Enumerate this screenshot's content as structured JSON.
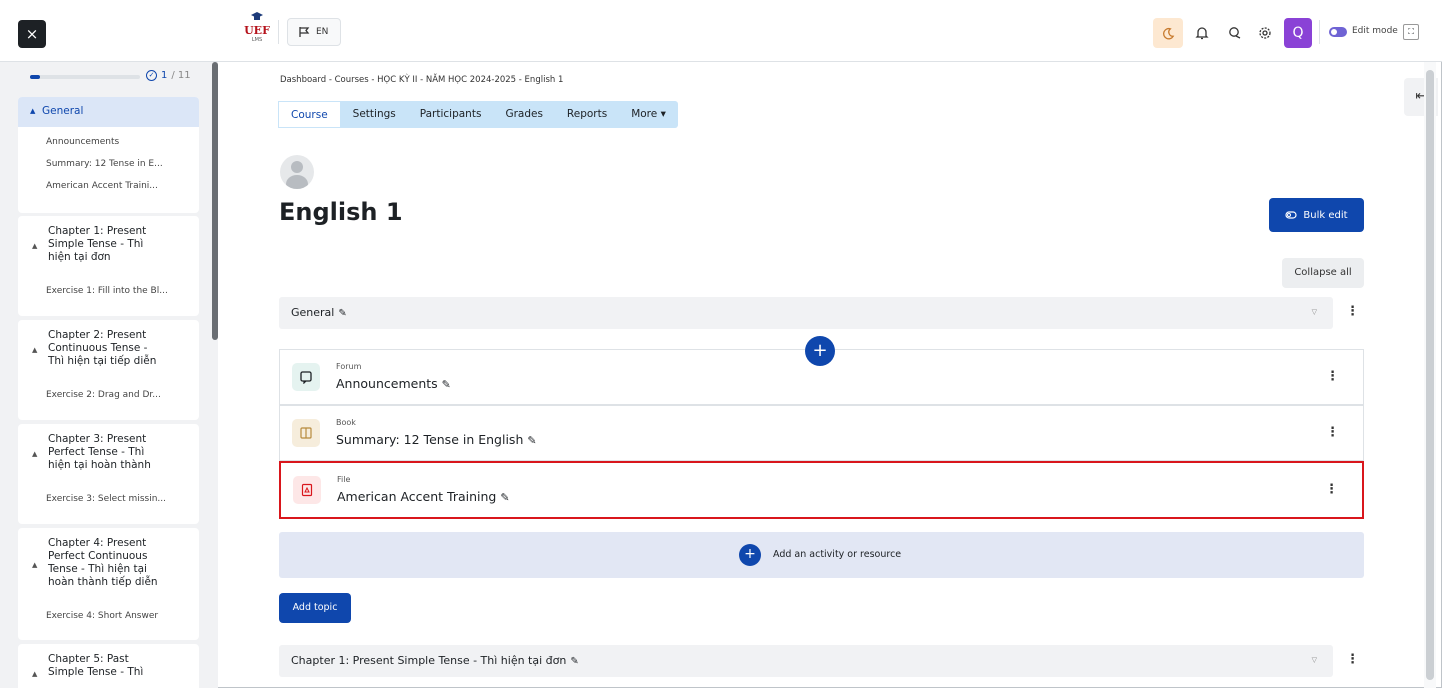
{
  "topbar": {
    "close_label": "×",
    "logo_text": "UEF",
    "logo_sub": "LMS",
    "lang_label": "EN",
    "user_initial": "Q",
    "edit_mode_label": "Edit mode"
  },
  "drawer": {
    "progress_done": "1",
    "progress_total": "/ 11",
    "progress_fraction": 0.09,
    "sections": [
      {
        "title": "General",
        "items": [
          "Announcements",
          "Summary: 12 Tense in E...",
          "American Accent Traini..."
        ]
      },
      {
        "title_lines": [
          "Chapter 1: Present",
          "Simple Tense - Thì",
          "hiện tại đơn"
        ],
        "items": [
          "Exercise 1: Fill into the Bl..."
        ]
      },
      {
        "title_lines": [
          "Chapter 2: Present",
          "Continuous Tense -",
          "Thì hiện tại tiếp diễn"
        ],
        "items": [
          "Exercise 2: Drag and Dr..."
        ]
      },
      {
        "title_lines": [
          "Chapter 3: Present",
          "Perfect Tense - Thì",
          "hiện tại hoàn thành"
        ],
        "items": [
          "Exercise 3: Select missin..."
        ]
      },
      {
        "title_lines": [
          "Chapter 4: Present",
          "Perfect Continuous",
          "Tense - Thì hiện tại",
          "hoàn thành tiếp diễn"
        ],
        "items": [
          "Exercise 4: Short Answer"
        ]
      },
      {
        "title_lines": [
          "Chapter 5: Past",
          "Simple Tense - Thì"
        ],
        "items": []
      }
    ]
  },
  "breadcrumb": "Dashboard  -  Courses  -  HỌC KỲ II - NĂM HỌC 2024-2025  -  English 1",
  "tabs": [
    "Course",
    "Settings",
    "Participants",
    "Grades",
    "Reports",
    "More ▾"
  ],
  "page_title": "English 1",
  "bulk_edit_label": "Bulk edit",
  "collapse_all_label": "Collapse all",
  "general_section_label": "General",
  "activities": [
    {
      "type": "Forum",
      "name": "Announcements",
      "icon": "forum-icon",
      "color": "#e5f3f0"
    },
    {
      "type": "Book",
      "name": "Summary: 12 Tense in English",
      "icon": "book-icon",
      "color": "#f6eddc"
    },
    {
      "type": "File",
      "name": "American Accent Training",
      "icon": "pdf-file-icon",
      "color": "#fde7e7"
    }
  ],
  "add_activity_label": "Add an activity or resource",
  "add_topic_label": "Add topic",
  "chapter1_section_label": "Chapter 1: Present Simple Tense - Thì hiện tại đơn",
  "colors": {
    "primary": "#0f47ad",
    "highlight": "#d9161c",
    "tabs_bg": "#c9e4f8"
  }
}
